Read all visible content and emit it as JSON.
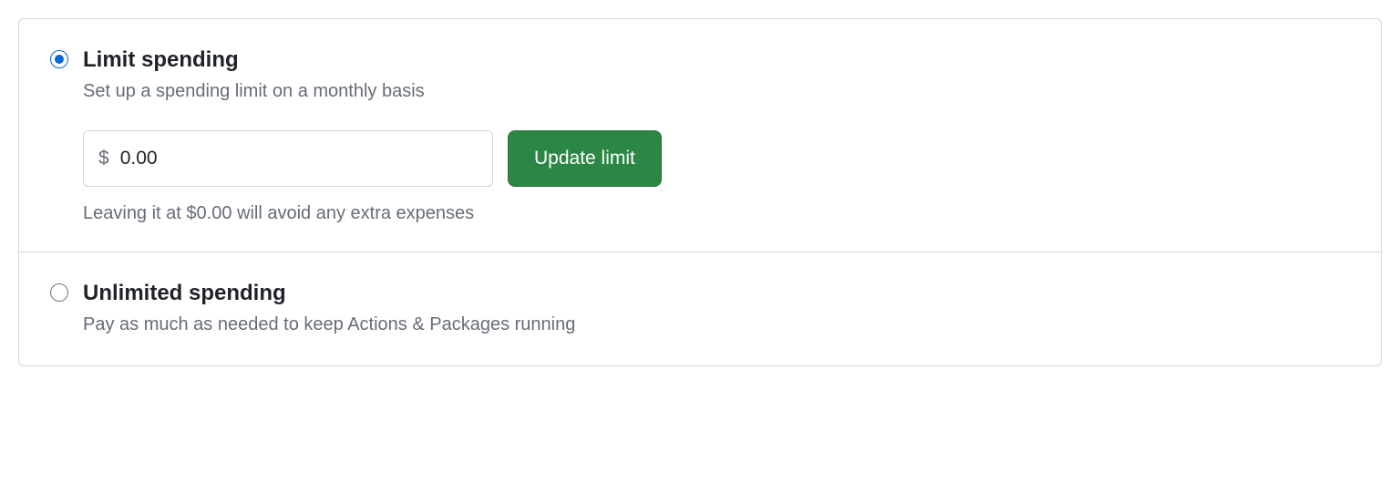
{
  "options": {
    "limit": {
      "title": "Limit spending",
      "description": "Set up a spending limit on a monthly basis",
      "selected": true,
      "currency_symbol": "$",
      "amount_value": "0.00",
      "button_label": "Update limit",
      "hint": "Leaving it at $0.00 will avoid any extra expenses"
    },
    "unlimited": {
      "title": "Unlimited spending",
      "description": "Pay as much as needed to keep Actions & Packages running",
      "selected": false
    }
  }
}
